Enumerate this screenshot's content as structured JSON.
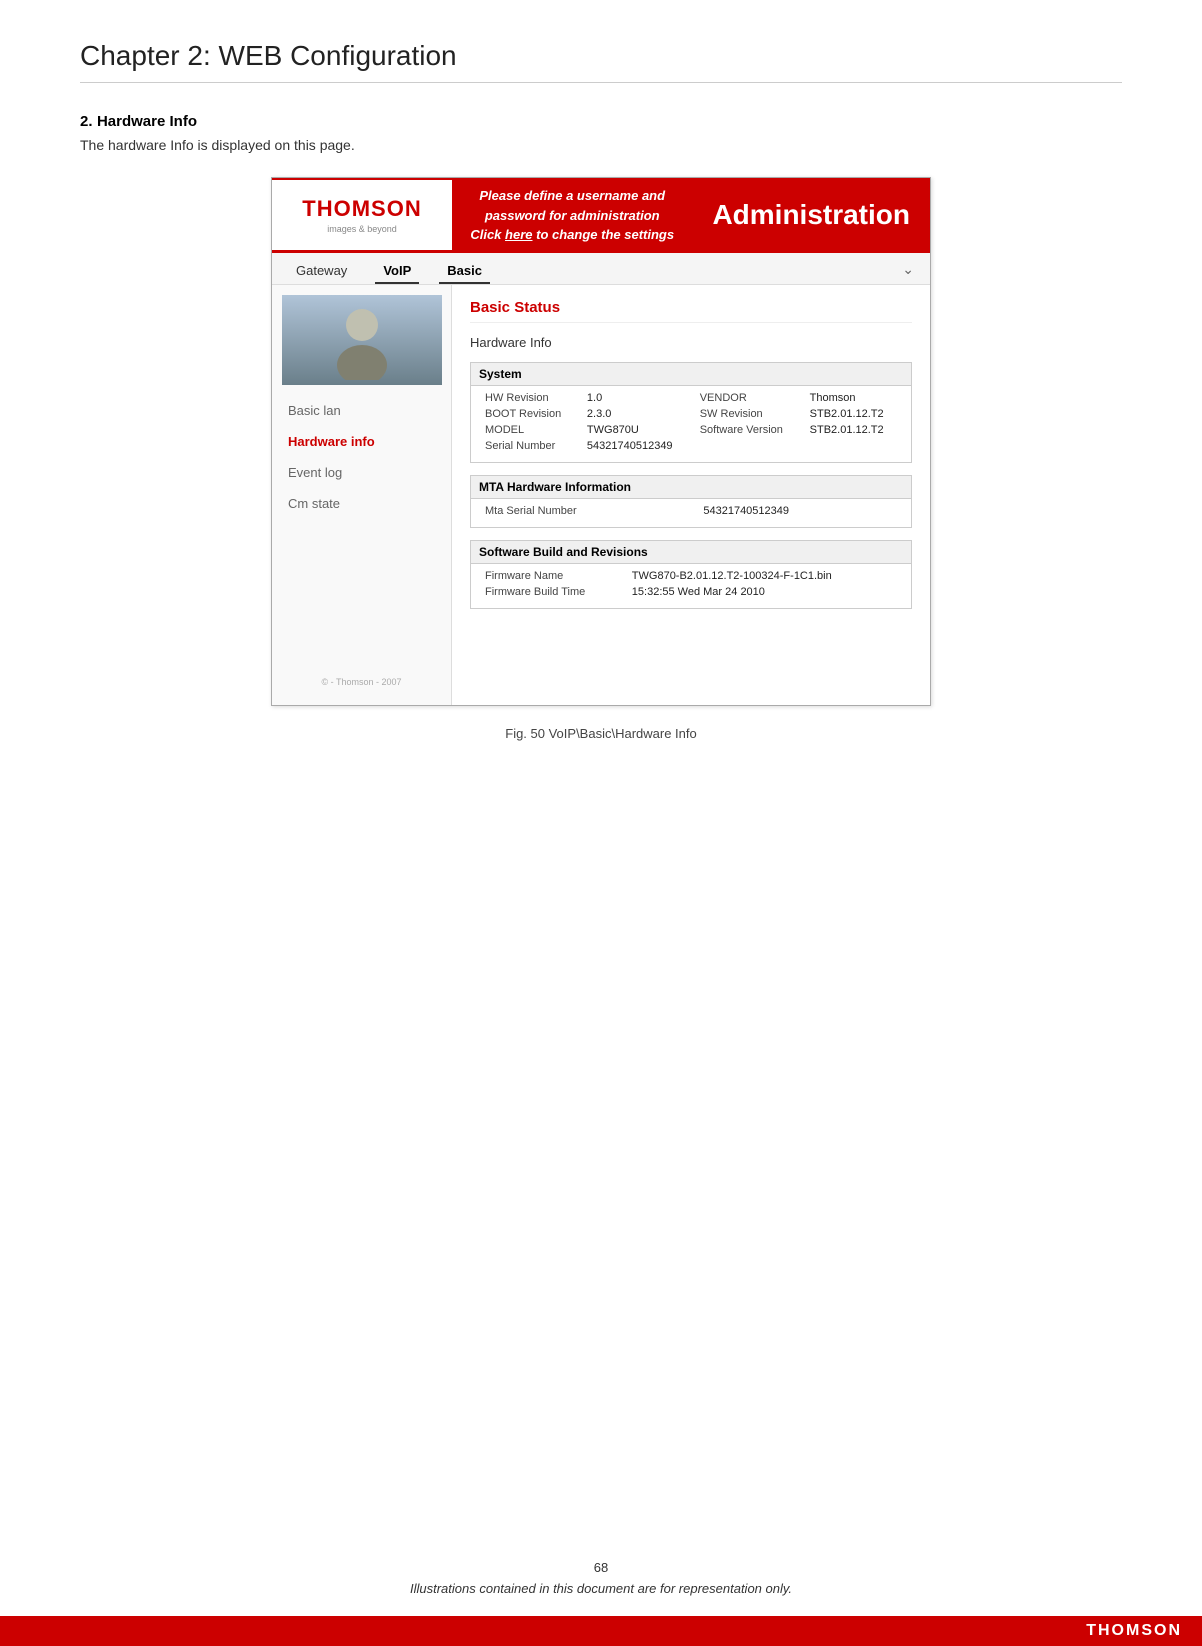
{
  "page": {
    "chapter_title": "Chapter 2: WEB Configuration",
    "section_number": "2.",
    "section_title": "Hardware Info",
    "section_desc": "The hardware Info is displayed on this page.",
    "figure_caption": "Fig. 50 VoIP\\Basic\\Hardware Info",
    "page_number": "68",
    "footer_note": "Illustrations contained in this document are for representation only."
  },
  "header": {
    "message_line1": "Please define a username and password for administration",
    "message_line2": "Click here to change the settings",
    "admin_label": "Administration"
  },
  "nav": {
    "tabs": [
      "Gateway",
      "VoIP",
      "Basic"
    ],
    "active_tab": "Basic"
  },
  "sidebar": {
    "items": [
      {
        "label": "Basic lan",
        "active": false
      },
      {
        "label": "Hardware info",
        "active": true
      },
      {
        "label": "Event log",
        "active": false
      },
      {
        "label": "Cm state",
        "active": false
      }
    ],
    "copyright": "© - Thomson - 2007"
  },
  "main": {
    "section_title": "Basic Status",
    "sub_title": "Hardware Info",
    "system_table": {
      "header": "System",
      "rows": [
        {
          "col1_label": "HW Revision",
          "col1_value": "1.0",
          "col2_label": "VENDOR",
          "col2_value": "Thomson"
        },
        {
          "col1_label": "BOOT Revision",
          "col1_value": "2.3.0",
          "col2_label": "SW Revision",
          "col2_value": "STB2.01.12.T2"
        },
        {
          "col1_label": "MODEL",
          "col1_value": "TWG870U",
          "col2_label": "Software Version",
          "col2_value": "STB2.01.12.T2"
        },
        {
          "col1_label": "Serial Number",
          "col1_value": "54321740512349",
          "col2_label": "",
          "col2_value": ""
        }
      ]
    },
    "mta_table": {
      "header": "MTA Hardware Information",
      "rows": [
        {
          "label": "Mta Serial Number",
          "value": "54321740512349"
        }
      ]
    },
    "software_table": {
      "header": "Software Build and Revisions",
      "rows": [
        {
          "label": "Firmware Name",
          "value": "TWG870-B2.01.12.T2-100324-F-1C1.bin"
        },
        {
          "label": "Firmware Build Time",
          "value": "15:32:55 Wed Mar 24 2010"
        }
      ]
    }
  },
  "thomson": {
    "logo": "THOMSON",
    "tagline": "images & beyond",
    "bottom_logo": "THOMSON"
  }
}
